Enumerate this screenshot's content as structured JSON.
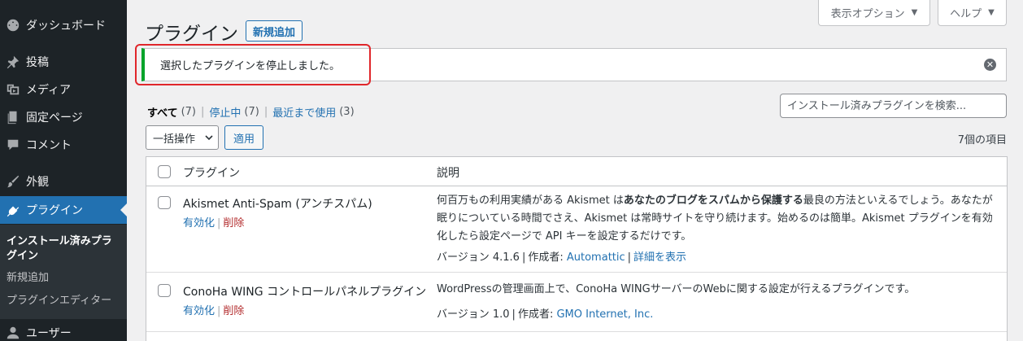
{
  "sidebar": {
    "dashboard": "ダッシュボード",
    "posts": "投稿",
    "media": "メディア",
    "pages": "固定ページ",
    "comments": "コメント",
    "appearance": "外観",
    "plugins": "プラグイン",
    "submenu": {
      "installed": "インストール済みプラグイン",
      "add_new": "新規追加",
      "editor": "プラグインエディター"
    },
    "users": "ユーザー"
  },
  "top_tabs": {
    "screen_options": "表示オプション",
    "help": "ヘルプ"
  },
  "header": {
    "title": "プラグイン",
    "add_new": "新規追加"
  },
  "notice": {
    "message": "選択したプラグインを停止しました。"
  },
  "filters": {
    "all_label": "すべて",
    "all_count": "(7)",
    "inactive_label": "停止中",
    "inactive_count": "(7)",
    "recent_label": "最近まで使用",
    "recent_count": "(3)"
  },
  "search": {
    "placeholder": "インストール済みプラグインを検索..."
  },
  "bulk": {
    "select_label": "一括操作",
    "apply_label": "適用",
    "items_count": "7個の項目"
  },
  "table": {
    "col_plugin": "プラグイン",
    "col_description": "説明",
    "rows": [
      {
        "name": "Akismet Anti-Spam (アンチスパム)",
        "activate": "有効化",
        "delete": "削除",
        "desc_pre": "何百万もの利用実績がある Akismet は",
        "desc_bold": "あなたのブログをスパムから保護する",
        "desc_post": "最良の方法といえるでしょう。あなたが眠りについている時間でさえ、Akismet は常時サイトを守り続けます。始めるのは簡単。Akismet プラグインを有効化したら設定ページで API キーを設定するだけです。",
        "version": "バージョン 4.1.6",
        "author_label": "作成者:",
        "author": "Automattic",
        "details": "詳細を表示"
      },
      {
        "name": "ConoHa WING コントロールパネルプラグイン",
        "activate": "有効化",
        "delete": "削除",
        "desc": "WordPressの管理画面上で、ConoHa WINGサーバーのWebに関する設定が行えるプラグインです。",
        "version": "バージョン 1.0",
        "author_label": "作成者:",
        "author": "GMO Internet, Inc."
      }
    ]
  },
  "colors": {
    "sidebar_bg": "#1d2327",
    "accent": "#2271b1",
    "notice_success": "#00a32a",
    "highlight": "#e0262b",
    "delete": "#b32d2e"
  }
}
